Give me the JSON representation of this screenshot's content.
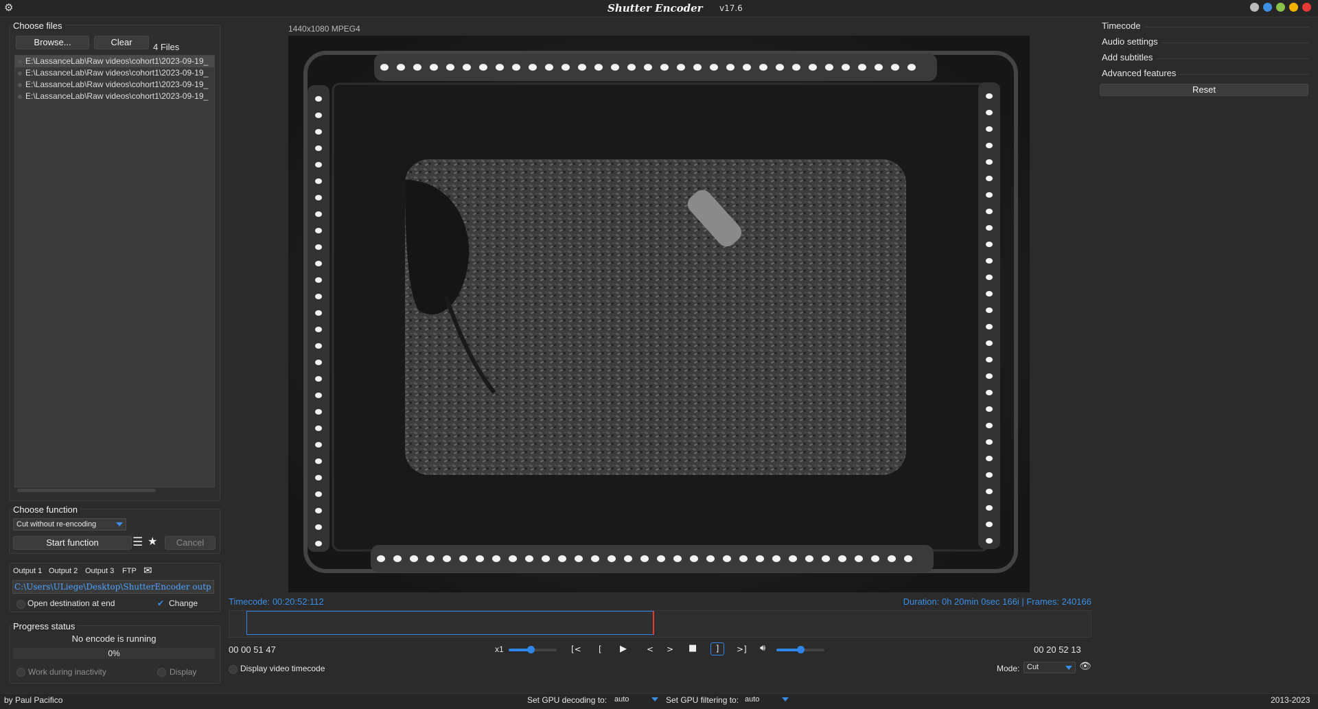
{
  "app": {
    "title": "Shutter Encoder",
    "version": "v17.6"
  },
  "window": {
    "controls": [
      "globe-icon",
      "help-icon",
      "minimize-icon",
      "maximize-icon",
      "close-icon"
    ]
  },
  "files": {
    "title": "Choose files",
    "browse_label": "Browse...",
    "clear_label": "Clear",
    "count": "4 Files",
    "items": [
      "E:\\LassanceLab\\Raw videos\\cohort1\\2023-09-19_",
      "E:\\LassanceLab\\Raw videos\\cohort1\\2023-09-19_",
      "E:\\LassanceLab\\Raw videos\\cohort1\\2023-09-19_",
      "E:\\LassanceLab\\Raw videos\\cohort1\\2023-09-19_"
    ]
  },
  "function": {
    "title": "Choose function",
    "selected": "Cut without re-encoding",
    "start_label": "Start function",
    "cancel_label": "Cancel"
  },
  "output": {
    "tabs": [
      "Output 1",
      "Output 2",
      "Output 3",
      "FTP"
    ],
    "path": "C:\\Users\\ULiege\\Desktop\\ShutterEncoder outp",
    "open_dest_label": "Open destination at end",
    "change_label": "Change"
  },
  "progress": {
    "title": "Progress status",
    "status": "No encode is running",
    "percent": "0%",
    "work_inactivity_label": "Work during inactivity",
    "display_label": "Display"
  },
  "preview": {
    "info": "1440x1080 MPEG4",
    "timecode": "Timecode: 00:20:52:112",
    "duration": "Duration: 0h 20min 0sec 166i | Frames: 240166",
    "in_tc": [
      "00",
      "00",
      "51",
      "47"
    ],
    "out_tc": [
      "00",
      "20",
      "52",
      "13"
    ],
    "speed": "x1",
    "speed_level": 0.45,
    "volume_level": 0.5,
    "display_tc_label": "Display video timecode",
    "mode_label": "Mode:",
    "mode_value": "Cut"
  },
  "settings": {
    "sections": [
      "Timecode",
      "Audio settings",
      "Add subtitles",
      "Advanced features"
    ],
    "reset_label": "Reset"
  },
  "footer": {
    "author": "by Paul Pacifico",
    "gpu_decoding_label": "Set GPU decoding to:",
    "gpu_decoding_value": "auto",
    "gpu_filtering_label": "Set GPU filtering to:",
    "gpu_filtering_value": "auto",
    "years": "2013-2023"
  }
}
